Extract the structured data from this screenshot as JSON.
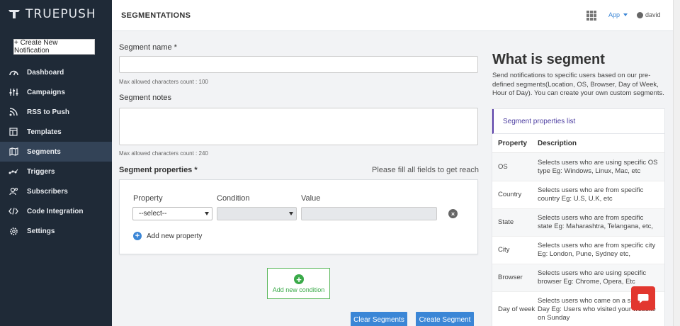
{
  "app": {
    "logo_text": "TRUEPUSH"
  },
  "sidebar": {
    "create_button": "+ Create New Notification",
    "items": [
      {
        "label": "Dashboard",
        "icon": "dashboard-icon"
      },
      {
        "label": "Campaigns",
        "icon": "campaigns-icon"
      },
      {
        "label": "RSS to Push",
        "icon": "rss-icon"
      },
      {
        "label": "Templates",
        "icon": "templates-icon"
      },
      {
        "label": "Segments",
        "icon": "segments-icon",
        "active": true
      },
      {
        "label": "Triggers",
        "icon": "triggers-icon"
      },
      {
        "label": "Subscribers",
        "icon": "subscribers-icon"
      },
      {
        "label": "Code Integration",
        "icon": "code-icon"
      },
      {
        "label": "Settings",
        "icon": "gear-icon"
      }
    ]
  },
  "header": {
    "title": "SEGMENTATIONS",
    "app_dropdown": "App",
    "user": "david"
  },
  "form": {
    "segment_name_label": "Segment name *",
    "segment_name_hint": "Max allowed characters count : 100",
    "segment_notes_label": "Segment notes",
    "segment_notes_hint": "Max allowed characters count : 240",
    "properties_label": "Segment properties *",
    "properties_warning": "Please fill all fields to get reach",
    "col_property": "Property",
    "col_condition": "Condition",
    "col_value": "Value",
    "property_select": "--select--",
    "add_property": "Add new property",
    "add_condition": "Add new condition",
    "clear_button": "Clear Segments",
    "create_button": "Create Segment"
  },
  "info": {
    "title": "What is segment",
    "description": "Send notifications to specific users based on our pre-defined segments(Location, OS, Browser, Day of Week, Hour of Day). You can create your own custom segments.",
    "panel_title": "Segment properties list",
    "col_property": "Property",
    "col_description": "Description",
    "rows": [
      {
        "property": "OS",
        "description": "Selects users who are using specific OS type Eg: Windows, Linux, Mac, etc"
      },
      {
        "property": "Country",
        "description": "Selects users who are from specific country Eg: U.S, U.K, etc"
      },
      {
        "property": "State",
        "description": "Selects users who are from specific state Eg: Maharashtra, Telangana, etc,"
      },
      {
        "property": "City",
        "description": "Selects users who are from specific city Eg: London, Pune, Sydney etc,"
      },
      {
        "property": "Browser",
        "description": "Selects users who are using specific browser Eg: Chrome, Opera, Etc"
      },
      {
        "property": "Day of week",
        "description": "Selects users who came on a specific Day Eg: Users who visited your website on Sunday"
      }
    ]
  },
  "colors": {
    "sidebar": "#1f2a37",
    "accent": "#3b86d6",
    "add_condition": "#3aaa49",
    "chat": "#e2372f"
  }
}
